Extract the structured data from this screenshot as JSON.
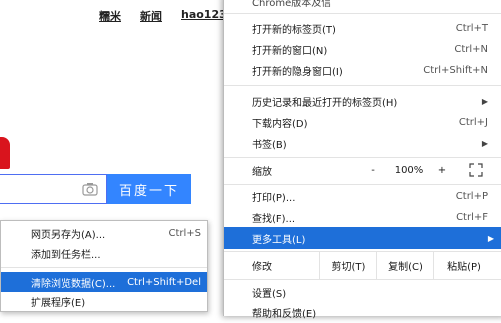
{
  "page": {
    "nav_links": [
      "糯米",
      "新闻",
      "hao123"
    ],
    "search_button": "百度一下",
    "colors": {
      "brand_red": "#d9141d",
      "button_blue": "#3385ff",
      "menu_highlight": "#1e6fd9"
    }
  },
  "main_menu": {
    "title_partial": "Chrome版本及信",
    "new_tab": {
      "label": "打开新的标签页(T)",
      "shortcut": "Ctrl+T"
    },
    "new_window": {
      "label": "打开新的窗口(N)",
      "shortcut": "Ctrl+N"
    },
    "incognito": {
      "label": "打开新的隐身窗口(I)",
      "shortcut": "Ctrl+Shift+N"
    },
    "history": {
      "label": "历史记录和最近打开的标签页(H)"
    },
    "downloads": {
      "label": "下载内容(D)",
      "shortcut": "Ctrl+J"
    },
    "bookmarks": {
      "label": "书签(B)"
    },
    "zoom": {
      "label": "缩放",
      "minus": "-",
      "value": "100%",
      "plus": "+"
    },
    "print": {
      "label": "打印(P)...",
      "shortcut": "Ctrl+P"
    },
    "find": {
      "label": "查找(F)...",
      "shortcut": "Ctrl+F"
    },
    "more_tools": {
      "label": "更多工具(L)"
    },
    "edit": {
      "label": "修改",
      "cut": "剪切(T)",
      "copy": "复制(C)",
      "paste": "粘贴(P)"
    },
    "settings": {
      "label": "设置(S)"
    },
    "help_partial": {
      "label": "帮助和反馈(E)"
    }
  },
  "sub_menu": {
    "save_page": {
      "label": "网页另存为(A)...",
      "shortcut": "Ctrl+S"
    },
    "add_taskbar": {
      "label": "添加到任务栏..."
    },
    "clear_data": {
      "label": "清除浏览数据(C)...",
      "shortcut": "Ctrl+Shift+Del"
    },
    "extensions": {
      "label": "扩展程序(E)"
    }
  }
}
